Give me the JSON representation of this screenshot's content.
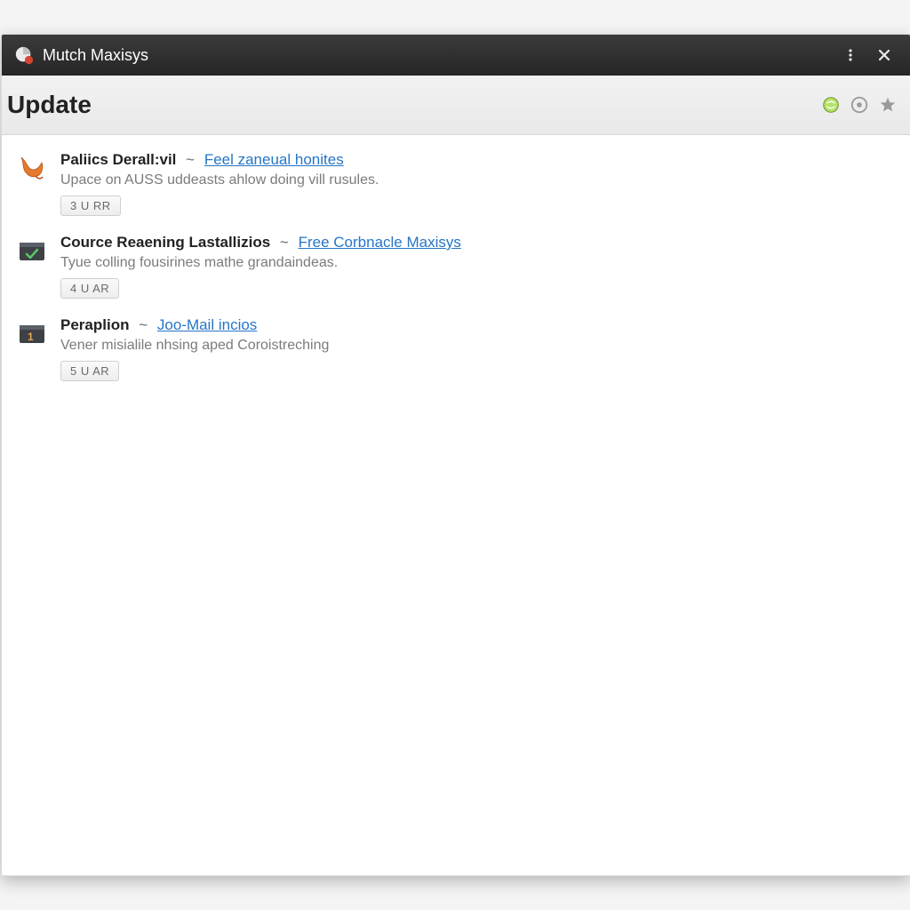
{
  "titlebar": {
    "app_name": "Mutch Maxisys"
  },
  "subheader": {
    "title": "Update"
  },
  "items": [
    {
      "name": "Paliics Derall:vil",
      "link": "Feel zaneual honites",
      "desc": "Upace on AUSS uddeasts ahlow doing vill rusules.",
      "badge": "3 U RR"
    },
    {
      "name": "Cource Reaening Lastallizios",
      "link": "Free Corbnacle Maxisys",
      "desc": "Tyue colling fousirines mathe grandaindeas.",
      "badge": "4 U AR"
    },
    {
      "name": "Peraplion",
      "link": "Joo-Mail incios",
      "desc": "Vener misialile nhsing aped Coroistreching",
      "badge": "5 U AR"
    }
  ]
}
